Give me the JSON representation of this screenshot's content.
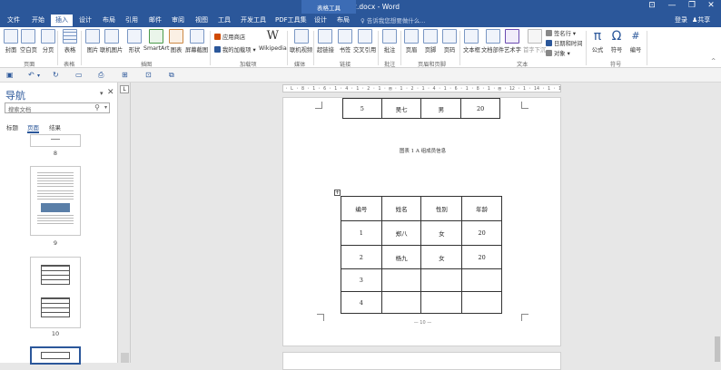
{
  "window": {
    "title": "Word教程2.docx - Word",
    "min": "—",
    "restore": "❐",
    "close": "✕",
    "opts": "⊡"
  },
  "context_group": "表格工具",
  "tabs": [
    "文件",
    "开始",
    "插入",
    "设计",
    "布局",
    "引用",
    "邮件",
    "审阅",
    "视图",
    "工具",
    "开发工具",
    "PDF工具集",
    "设计",
    "布局"
  ],
  "tell_me": "告诉我您想要做什么...",
  "account": {
    "login": "登录",
    "share": "共享"
  },
  "ribbon": {
    "pages": [
      "封面",
      "空白页",
      "分页"
    ],
    "table": "表格",
    "illustrations": [
      "图片",
      "联机图片",
      "形状",
      "SmartArt",
      "图表",
      "屏幕截图"
    ],
    "addins": {
      "store": "应用商店",
      "myaddins": "我的加载项",
      "wikipedia": "Wikipedia"
    },
    "media": "联机视频",
    "links": [
      "超链接",
      "书签",
      "交叉引用"
    ],
    "comment": "批注",
    "header_footer": [
      "页眉",
      "页脚",
      "页码"
    ],
    "text": [
      "文本框",
      "文档部件",
      "艺术字",
      "首字下沉"
    ],
    "text_small": [
      "签名行",
      "日期和时间",
      "对象"
    ],
    "symbols": [
      "公式",
      "符号",
      "编号"
    ],
    "groups": [
      "页面",
      "表格",
      "插图",
      "加载项",
      "媒体",
      "链接",
      "批注",
      "页眉和页脚",
      "文本",
      "符号"
    ]
  },
  "nav": {
    "title": "导航",
    "search_placeholder": "搜索文档",
    "tabs": [
      "标题",
      "页面",
      "结果"
    ],
    "page_numbers": [
      "8",
      "9",
      "10"
    ]
  },
  "ruler_text": "· L · 8 · 1 · 6 · 1 · 4 · 1 · 2 · 1 · ▤ · 1 · 2 · 1 · 4 · 1 · 6 · 1 · 8 · 1 · ▤ · 12 · 1 · 14 · 1 · 16 · 1 · 18 · 1 · 20 · 1 · 22 · 1 · ▤ · 1 · 26 · 1 · 28 · 1 · 30 · 1 · ▤ · 34 · 1 · 36 · 1 · 38 · 1 · ▤",
  "doc": {
    "top_row": [
      "5",
      "吴七",
      "男",
      "20"
    ],
    "caption": "图表 1   A 组成员信息",
    "table": {
      "header": [
        "编号",
        "姓名",
        "性别",
        "年龄"
      ],
      "rows": [
        [
          "1",
          "郑八",
          "女",
          "20"
        ],
        [
          "2",
          "杨九",
          "女",
          "20"
        ],
        [
          "3",
          "",
          "",
          ""
        ],
        [
          "4",
          "",
          "",
          ""
        ]
      ]
    },
    "footer": "— 10 —"
  }
}
